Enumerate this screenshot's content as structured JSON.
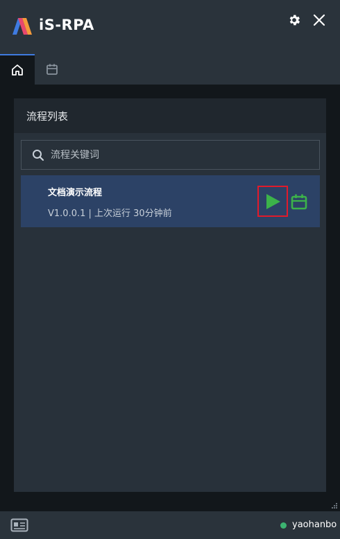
{
  "app": {
    "title": "iS-RPA"
  },
  "tabs": [
    {
      "name": "home",
      "icon": "home-icon",
      "active": true
    },
    {
      "name": "schedule",
      "icon": "calendar-icon",
      "active": false
    }
  ],
  "panel": {
    "title": "流程列表",
    "search_placeholder": "流程关键词"
  },
  "flows": [
    {
      "name": "文档演示流程",
      "meta": "V1.0.0.1 | 上次运行 30分钟前"
    }
  ],
  "status": {
    "username": "yaohanbo",
    "online": true
  },
  "colors": {
    "accent": "#3f7be0",
    "run_green": "#3cb34a",
    "highlight_red": "#e21a2b",
    "selected_row": "#2c4266"
  }
}
